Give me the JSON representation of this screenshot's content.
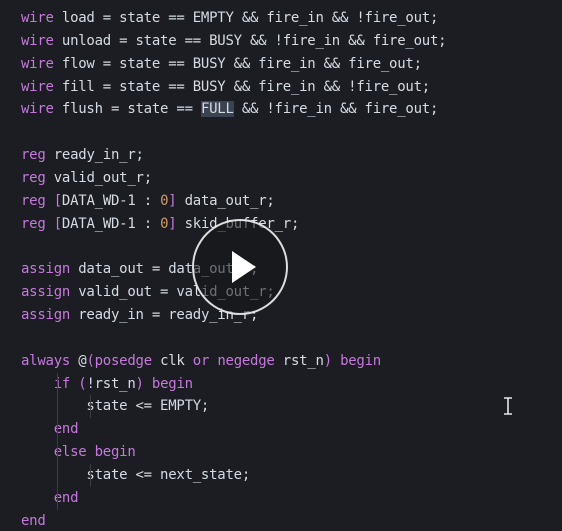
{
  "editor": {
    "lines": [
      [
        [
          "kw",
          "wire"
        ],
        [
          "op",
          " load = state == EMPTY && fire_in && !fire_out;"
        ]
      ],
      [
        [
          "kw",
          "wire"
        ],
        [
          "op",
          " unload = state == BUSY && !fire_in && fire_out;"
        ]
      ],
      [
        [
          "kw",
          "wire"
        ],
        [
          "op",
          " flow = state == BUSY && fire_in && fire_out;"
        ]
      ],
      [
        [
          "kw",
          "wire"
        ],
        [
          "op",
          " fill = state == BUSY && fire_in && !fire_out;"
        ]
      ],
      [
        [
          "kw",
          "wire"
        ],
        [
          "op",
          " flush = state == "
        ],
        [
          "sel",
          "FULL"
        ],
        [
          "op",
          " && !fire_in && fire_out;"
        ]
      ],
      [],
      [
        [
          "kw",
          "reg"
        ],
        [
          "op",
          " ready_in_r;"
        ]
      ],
      [
        [
          "kw",
          "reg"
        ],
        [
          "op",
          " valid_out_r;"
        ]
      ],
      [
        [
          "kw",
          "reg"
        ],
        [
          "op",
          " "
        ],
        [
          "br",
          "["
        ],
        [
          "op",
          "DATA_WD-1 : "
        ],
        [
          "num",
          "0"
        ],
        [
          "br",
          "]"
        ],
        [
          "op",
          " data_out_r;"
        ]
      ],
      [
        [
          "kw",
          "reg"
        ],
        [
          "op",
          " "
        ],
        [
          "br",
          "["
        ],
        [
          "op",
          "DATA_WD-1 : "
        ],
        [
          "num",
          "0"
        ],
        [
          "br",
          "]"
        ],
        [
          "op",
          " skid_buffer_r;"
        ]
      ],
      [],
      [
        [
          "kw",
          "assign"
        ],
        [
          "op",
          " data_out = data_out_r;"
        ]
      ],
      [
        [
          "kw",
          "assign"
        ],
        [
          "op",
          " valid_out = valid_out_r;"
        ]
      ],
      [
        [
          "kw",
          "assign"
        ],
        [
          "op",
          " ready_in = ready_in_r;"
        ]
      ],
      [],
      [
        [
          "kw",
          "always"
        ],
        [
          "op",
          " @"
        ],
        [
          "br",
          "("
        ],
        [
          "kw",
          "posedge"
        ],
        [
          "op",
          " clk "
        ],
        [
          "kw",
          "or"
        ],
        [
          "op",
          " "
        ],
        [
          "kw",
          "negedge"
        ],
        [
          "op",
          " rst_n"
        ],
        [
          "br",
          ")"
        ],
        [
          "op",
          " "
        ],
        [
          "kw",
          "begin"
        ]
      ],
      [
        [
          "op",
          "    "
        ],
        [
          "kw",
          "if"
        ],
        [
          "op",
          " "
        ],
        [
          "br",
          "("
        ],
        [
          "op",
          "!rst_n"
        ],
        [
          "br",
          ")"
        ],
        [
          "op",
          " "
        ],
        [
          "kw",
          "begin"
        ]
      ],
      [
        [
          "op",
          "        state <= EMPTY;"
        ]
      ],
      [
        [
          "op",
          "    "
        ],
        [
          "kw",
          "end"
        ]
      ],
      [
        [
          "op",
          "    "
        ],
        [
          "kw",
          "else begin"
        ]
      ],
      [
        [
          "op",
          "        state <= next_state;"
        ]
      ],
      [
        [
          "op",
          "    "
        ],
        [
          "kw",
          "end"
        ]
      ],
      [
        [
          "kw",
          "end"
        ]
      ]
    ]
  },
  "overlay": {
    "play_icon": "play-icon",
    "cursor_icon": "text-cursor-icon"
  },
  "colors": {
    "background": "#1b1d22",
    "keyword": "#c678dd",
    "text": "#d6dbe3",
    "number": "#d19a66"
  }
}
